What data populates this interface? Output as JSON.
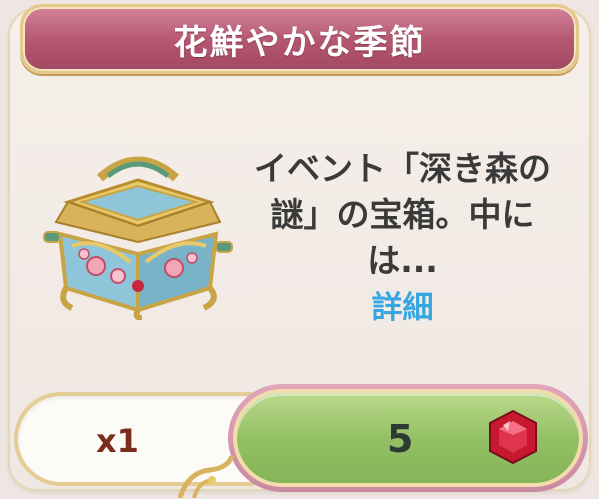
{
  "title": "花鮮やかな季節",
  "item": {
    "icon": "ornate-treasure-chest",
    "description": "イベント「深き森の謎」の宝箱。中には...",
    "detail_link": "詳細"
  },
  "purchase": {
    "quantity": "x1",
    "price": "5",
    "currency_icon": "red-gem-icon"
  },
  "colors": {
    "title_bar": "#b3556f",
    "button_green": "#94c064",
    "link_blue": "#36a6e3",
    "quantity_text": "#7a2d1d",
    "gold_trim": "#e4cc95"
  }
}
